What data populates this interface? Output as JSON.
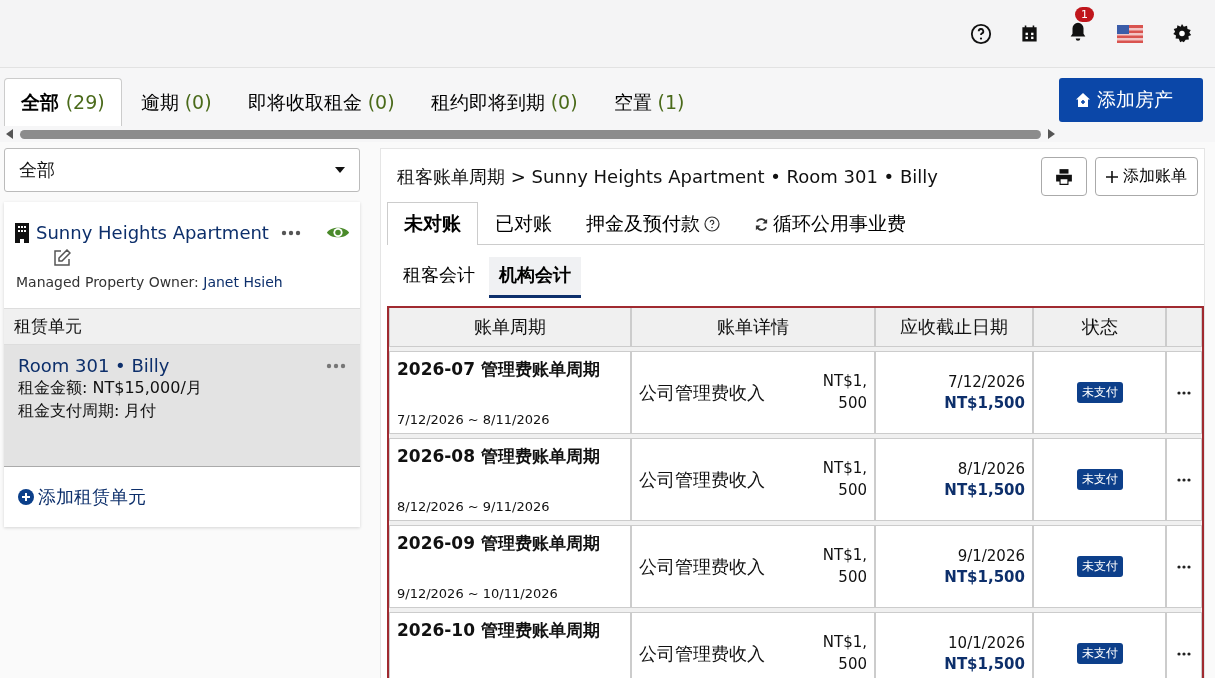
{
  "header": {
    "notification_count": "1"
  },
  "filter_tabs": [
    {
      "label": "全部",
      "count": "(29)",
      "selected": true
    },
    {
      "label": "逾期",
      "count": "(0)",
      "selected": false
    },
    {
      "label": "即将收取租金",
      "count": "(0)",
      "selected": false
    },
    {
      "label": "租约即将到期",
      "count": "(0)",
      "selected": false
    },
    {
      "label": "空置",
      "count": "(1)",
      "selected": false
    }
  ],
  "add_property_button": "添加房产",
  "sidebar": {
    "filter_select": "全部",
    "property": {
      "name": "Sunny Heights Apartment",
      "owner_label": "Managed Property Owner:",
      "owner": "Janet Hsieh"
    },
    "units_heading": "租赁单元",
    "units": [
      {
        "name": "Room 301 • Billy",
        "rent": "租金金额: NT$15,000/月",
        "cycle": "租金支付周期: 月付",
        "selected": true
      }
    ],
    "add_unit": "添加租赁单元"
  },
  "panel": {
    "breadcrumb": "租客账单周期 > Sunny Heights Apartment • Room 301 • Billy",
    "add_bill_button": "添加账单",
    "tabs": [
      {
        "label": "未对账",
        "kind": "plain",
        "selected": true
      },
      {
        "label": "已对账",
        "kind": "plain",
        "selected": false
      },
      {
        "label": "押金及预付款",
        "kind": "help",
        "selected": false
      },
      {
        "label": "循环公用事业费",
        "kind": "recurring",
        "selected": false
      }
    ],
    "subtabs": [
      {
        "label": "租客会计",
        "selected": false
      },
      {
        "label": "机构会计",
        "selected": true
      }
    ],
    "table": {
      "columns": [
        "账单周期",
        "账单详情",
        "应收截止日期",
        "状态"
      ],
      "rows": [
        {
          "title": "2026-07 管理费账单周期",
          "range": "7/12/2026 ~ 8/11/2026",
          "item": "公司管理费收入",
          "amount": "NT$1,500",
          "due_date": "7/12/2026",
          "due_amount": "NT$1,500",
          "status": "未支付"
        },
        {
          "title": "2026-08 管理费账单周期",
          "range": "8/12/2026 ~ 9/11/2026",
          "item": "公司管理费收入",
          "amount": "NT$1,500",
          "due_date": "8/1/2026",
          "due_amount": "NT$1,500",
          "status": "未支付"
        },
        {
          "title": "2026-09 管理费账单周期",
          "range": "9/12/2026 ~ 10/11/2026",
          "item": "公司管理费收入",
          "amount": "NT$1,500",
          "due_date": "9/1/2026",
          "due_amount": "NT$1,500",
          "status": "未支付"
        },
        {
          "title": "2026-10 管理费账单周期",
          "item": "公司管理费收入",
          "amount": "NT$1,500",
          "due_date": "10/1/2026",
          "due_amount": "NT$1,500",
          "status": "未支付"
        }
      ]
    }
  }
}
